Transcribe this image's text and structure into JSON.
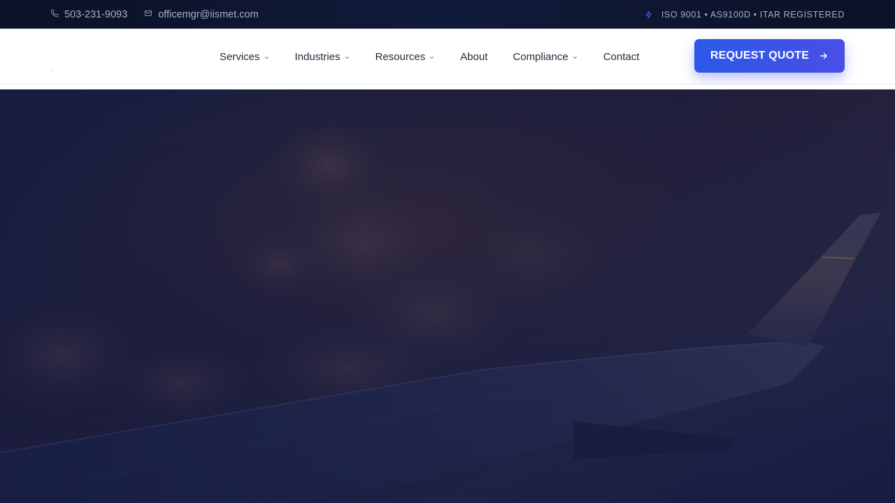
{
  "topbar": {
    "phone": "503-231-9093",
    "email": "officemgr@iismet.com",
    "certifications": "ISO 9001 • AS9100D • ITAR REGISTERED",
    "phone_icon": "phone-icon",
    "email_icon": "mail-icon",
    "cert_icon": "bolt-icon"
  },
  "nav": {
    "items": [
      {
        "label": "Services",
        "has_dropdown": true
      },
      {
        "label": "Industries",
        "has_dropdown": true
      },
      {
        "label": "Resources",
        "has_dropdown": true
      },
      {
        "label": "About",
        "has_dropdown": false
      },
      {
        "label": "Compliance",
        "has_dropdown": true
      },
      {
        "label": "Contact",
        "has_dropdown": false
      }
    ],
    "cta_label": "REQUEST QUOTE",
    "cta_icon": "arrow-right-icon"
  },
  "colors": {
    "accent": "#2b59e8",
    "topbar_bg": "#0b1126",
    "hero_overlay": "#141c44"
  }
}
